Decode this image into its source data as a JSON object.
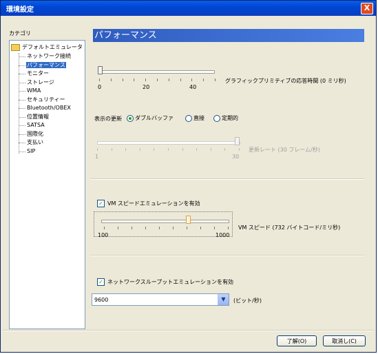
{
  "window": {
    "title": "環境設定",
    "close_glyph": "X"
  },
  "category_label": "カテゴリ",
  "tree": {
    "root": "デフォルトエミュレータ",
    "items": [
      "ネットワーク接続",
      "パフォーマンス",
      "モニター",
      "ストレージ",
      "WMA",
      "セキュリティー",
      "Bluetooth/OBEX",
      "位置情報",
      "SATSA",
      "国際化",
      "支払い",
      "SIP"
    ],
    "selected": "パフォーマンス"
  },
  "panel": {
    "header": "パフォーマンス",
    "graphics": {
      "label": "グラフィックプリミティブの応答時間 (0 ミリ秒)",
      "ticks": [
        "0",
        "20",
        "40"
      ],
      "value": 0
    },
    "display_update": {
      "label": "表示の更新",
      "options": [
        "ダブルバッファ",
        "直接",
        "定期的"
      ],
      "selected": "ダブルバッファ"
    },
    "refresh": {
      "label": "更新レート (30 フレーム/秒)",
      "ticks": [
        "1",
        "30"
      ],
      "value": 30,
      "enabled": false
    },
    "vm_speed": {
      "checkbox_label": "VM スピードエミュレーションを有効",
      "checked": true,
      "label": "VM スピード (732 バイトコード/ミリ秒)",
      "ticks": [
        "100",
        "1000"
      ],
      "value": 732
    },
    "network": {
      "checkbox_label": "ネットワークスループットエミュレーションを有効",
      "checked": true,
      "speed_value": "9600",
      "unit": "(ビット/秒)"
    }
  },
  "buttons": {
    "ok": "了解(O)",
    "cancel": "取消し(C)"
  },
  "colors": {
    "titlebar": "#0046d5",
    "header": "#2f5cc0",
    "selection": "#316ac5"
  }
}
